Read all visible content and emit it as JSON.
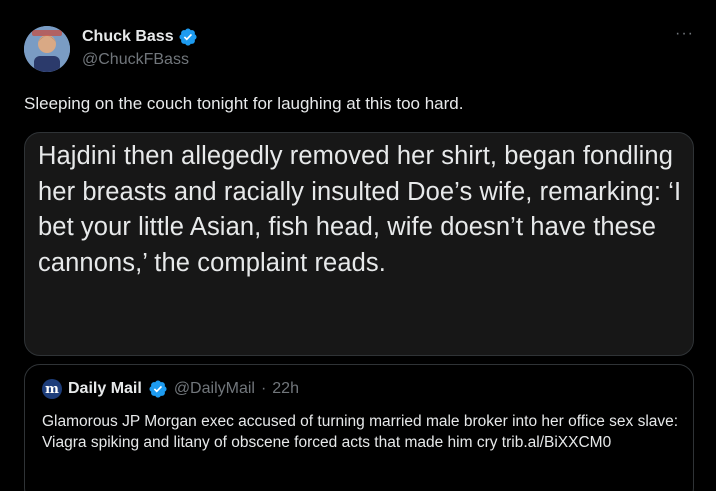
{
  "tweet": {
    "display_name": "Chuck Bass",
    "handle": "@ChuckFBass",
    "more_label": "···",
    "text": "Sleeping on the couch tonight for laughing at this too hard.",
    "media_text": "Hajdini then allegedly removed her shirt, began fondling her breasts and racially insulted Doe’s wife, remarking: ‘I bet your little Asian, fish head, wife doesn’t have these cannons,’ the complaint reads."
  },
  "quote": {
    "logo_letter": "m",
    "display_name": "Daily Mail",
    "handle": "@DailyMail",
    "separator": "·",
    "time": "22h",
    "text": "Glamorous JP Morgan exec accused of turning married male broker into her office sex slave: Viagra spiking and litany of obscene forced acts that made him cry trib.al/BiXXCM0"
  },
  "colors": {
    "background": "#000000",
    "text_primary": "#e7e9ea",
    "text_secondary": "#71767b",
    "verified_blue": "#1d9bf0",
    "border": "#2f3336",
    "media_bg": "#171717"
  },
  "icons": {
    "verified": "verified-badge-icon",
    "more": "more-options-icon",
    "daily_mail_logo": "daily-mail-logo-icon"
  }
}
